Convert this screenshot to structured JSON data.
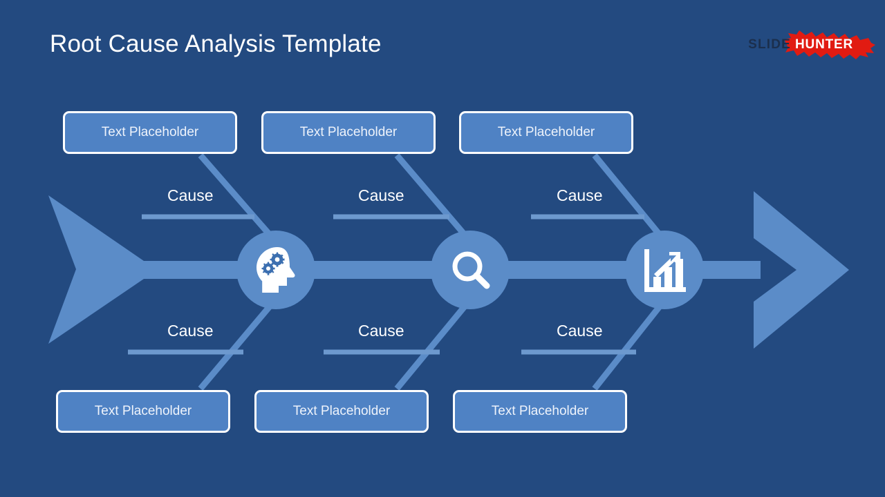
{
  "slide": {
    "title": "Root Cause Analysis Template",
    "background_color": "#234a80",
    "accent_color": "#5b8cc8",
    "box_fill_color": "#4f82c4",
    "border_color": "#ffffff",
    "text_color": "#ffffff"
  },
  "logo": {
    "word_one": "SLIDE",
    "word_two": "HUNTER",
    "splash_color": "#e11b12",
    "word_one_color": "#1b2f4d",
    "word_two_color": "#ffffff"
  },
  "diagram": {
    "type": "fishbone-ishikawa",
    "spine_label": "",
    "tail_name": "fish-tail",
    "head_name": "arrow-head",
    "top_branches": [
      {
        "cause_label": "Cause",
        "placeholder": "Text Placeholder"
      },
      {
        "cause_label": "Cause",
        "placeholder": "Text Placeholder"
      },
      {
        "cause_label": "Cause",
        "placeholder": "Text Placeholder"
      }
    ],
    "bottom_branches": [
      {
        "cause_label": "Cause",
        "placeholder": "Text Placeholder"
      },
      {
        "cause_label": "Cause",
        "placeholder": "Text Placeholder"
      },
      {
        "cause_label": "Cause",
        "placeholder": "Text Placeholder"
      }
    ],
    "nodes": [
      {
        "icon": "head-gears-icon",
        "label": ""
      },
      {
        "icon": "magnifier-icon",
        "label": ""
      },
      {
        "icon": "bar-chart-growth-icon",
        "label": ""
      }
    ]
  }
}
